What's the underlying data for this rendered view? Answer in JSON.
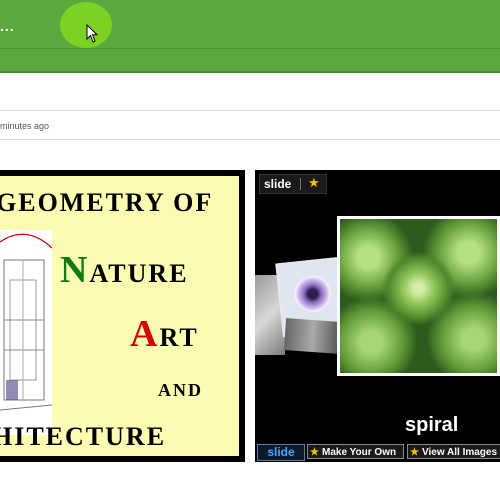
{
  "header": {
    "title_ellipsis": "...",
    "accent_color": "#5aa83e"
  },
  "meta": {
    "timestamp": "minutes ago"
  },
  "poster": {
    "line1": "GEOMETRY OF",
    "line2_cap": "N",
    "line2_rest": "ATURE",
    "line3_cap": "A",
    "line3_rest": "RT",
    "line4": "AND",
    "line5": "HITECTURE",
    "cap_colors": {
      "nature": "#0f7a0f",
      "art": "#d40000"
    },
    "background": "#fbfbb2"
  },
  "slideshow": {
    "logo_word": "slide",
    "caption": "spiral",
    "bottom_logo": "slide",
    "make_your_own": "Make Your Own",
    "view_all": "View All Images"
  },
  "icons": {
    "cursor": "mouse-pointer-icon",
    "star": "star-icon"
  }
}
